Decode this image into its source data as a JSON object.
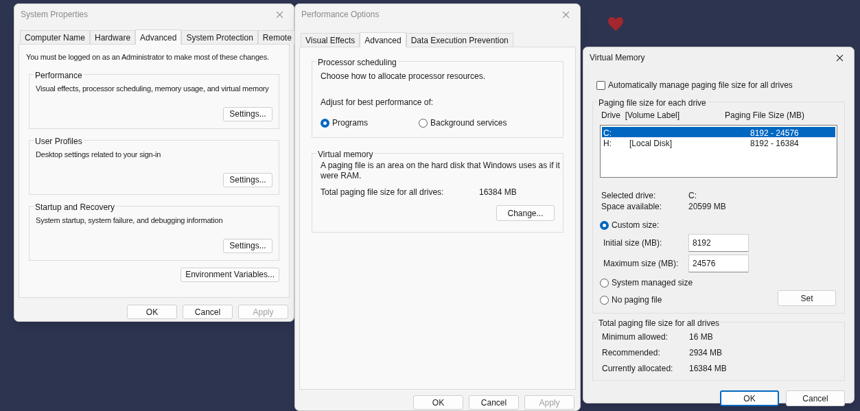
{
  "system_properties": {
    "title": "System Properties",
    "tabs": [
      {
        "label": "Computer Name",
        "selected": false
      },
      {
        "label": "Hardware",
        "selected": false
      },
      {
        "label": "Advanced",
        "selected": true
      },
      {
        "label": "System Protection",
        "selected": false
      },
      {
        "label": "Remote",
        "selected": false
      }
    ],
    "notice": "You must be logged on as an Administrator to make most of these changes.",
    "groups": [
      {
        "title": "Performance",
        "description": "Visual effects, processor scheduling, memory usage, and virtual memory",
        "button": "Settings..."
      },
      {
        "title": "User Profiles",
        "description": "Desktop settings related to your sign-in",
        "button": "Settings..."
      },
      {
        "title": "Startup and Recovery",
        "description": "System startup, system failure, and debugging information",
        "button": "Settings..."
      }
    ],
    "environment_button": "Environment Variables...",
    "buttons": [
      {
        "label": "OK",
        "disabled": false
      },
      {
        "label": "Cancel",
        "disabled": false
      },
      {
        "label": "Apply",
        "disabled": true
      }
    ]
  },
  "performance_options": {
    "title": "Performance Options",
    "tabs": [
      {
        "label": "Visual Effects",
        "selected": false
      },
      {
        "label": "Advanced",
        "selected": true
      },
      {
        "label": "Data Execution Prevention",
        "selected": false
      }
    ],
    "processor_scheduling": {
      "title": "Processor scheduling",
      "description": "Choose how to allocate processor resources.",
      "prompt": "Adjust for best performance of:",
      "options": [
        {
          "label": "Programs",
          "selected": true
        },
        {
          "label": "Background services",
          "selected": false
        }
      ]
    },
    "virtual_memory": {
      "title": "Virtual memory",
      "description": "A paging file is an area on the hard disk that Windows uses as if it were RAM.",
      "total_label": "Total paging file size for all drives:",
      "total_value": "16384 MB",
      "button": "Change..."
    },
    "buttons": [
      {
        "label": "OK",
        "disabled": false
      },
      {
        "label": "Cancel",
        "disabled": false
      },
      {
        "label": "Apply",
        "disabled": true
      }
    ]
  },
  "virtual_memory": {
    "title": "Virtual Memory",
    "auto_manage": {
      "label": "Automatically manage paging file size for all drives",
      "checked": false
    },
    "group_title": "Paging file size for each drive",
    "columns": [
      "Drive  [Volume Label]",
      "Paging File Size (MB)"
    ],
    "drives": [
      {
        "drive": "C:",
        "size": "8192 - 24576",
        "selected": true
      },
      {
        "drive": "H:",
        "label": "[Local Disk]",
        "size": "8192 - 16384",
        "selected": false
      }
    ],
    "info": [
      {
        "label": "Selected drive:",
        "value": "C:"
      },
      {
        "label": "Space available:",
        "value": "20599 MB"
      }
    ],
    "size_options": [
      {
        "label": "Custom size:",
        "selected": true
      },
      {
        "label": "System managed size",
        "selected": false
      },
      {
        "label": "No paging file",
        "selected": false
      }
    ],
    "fields": [
      {
        "label": "Initial size (MB):",
        "value": "8192"
      },
      {
        "label": "Maximum size (MB):",
        "value": "24576"
      }
    ],
    "set_button": "Set",
    "totals_title": "Total paging file size for all drives",
    "totals": [
      {
        "label": "Minimum allowed:",
        "value": "16 MB"
      },
      {
        "label": "Recommended:",
        "value": "2934 MB"
      },
      {
        "label": "Currently allocated:",
        "value": "16384 MB"
      }
    ],
    "buttons": [
      {
        "label": "OK",
        "default": true
      },
      {
        "label": "Cancel",
        "default": false
      }
    ]
  }
}
